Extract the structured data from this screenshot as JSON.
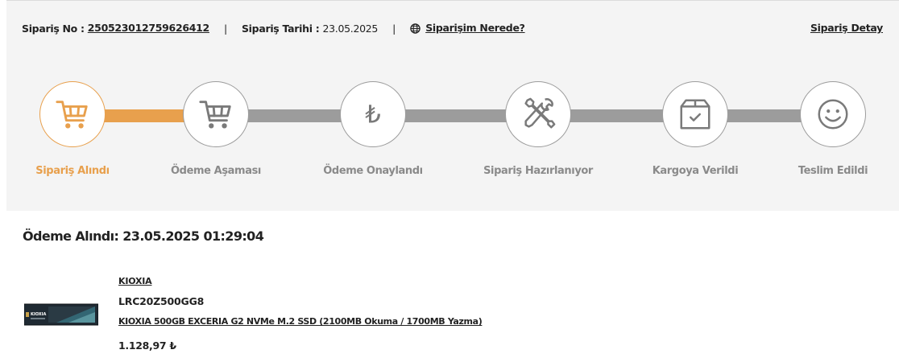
{
  "header": {
    "order_no_label": "Sipariş No :",
    "order_no_value": "250523012759626412",
    "separator": "|",
    "order_date_label": "Sipariş Tarihi :",
    "order_date_value": "23.05.2025",
    "where_link": "Siparişim Nerede?",
    "detail_link": "Sipariş Detay"
  },
  "tracker": {
    "accent_color": "#e8a04d",
    "inactive_color": "#9c9c9c",
    "completed_steps": 1,
    "steps": [
      {
        "label": "Sipariş Alındı",
        "icon": "shopping-cart-icon",
        "active": true
      },
      {
        "label": "Ödeme Aşaması",
        "icon": "shopping-cart-icon",
        "active": false
      },
      {
        "label": "Ödeme Onaylandı",
        "icon": "turkish-lira-icon",
        "active": false
      },
      {
        "label": "Sipariş Hazırlanıyor",
        "icon": "tools-icon",
        "active": false
      },
      {
        "label": "Kargoya Verildi",
        "icon": "package-icon",
        "active": false
      },
      {
        "label": "Teslim Edildi",
        "icon": "smiley-icon",
        "active": false
      }
    ],
    "lira_symbol": "₺"
  },
  "payment": {
    "text": "Ödeme Alındı: 23.05.2025 01:29:04"
  },
  "product": {
    "brand": "KIOXIA",
    "code": "LRC20Z500GG8",
    "name": "KIOXIA 500GB EXCERIA G2 NVMe M.2 SSD (2100MB Okuma / 1700MB Yazma)",
    "price": "1.128,97 ₺",
    "image_label": "KIOXIA"
  }
}
